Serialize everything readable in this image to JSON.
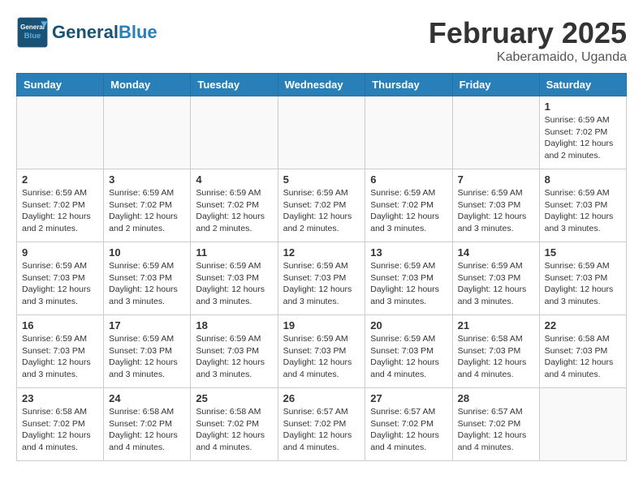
{
  "header": {
    "logo_general": "General",
    "logo_blue": "Blue",
    "month": "February 2025",
    "location": "Kaberamaido, Uganda"
  },
  "days_of_week": [
    "Sunday",
    "Monday",
    "Tuesday",
    "Wednesday",
    "Thursday",
    "Friday",
    "Saturday"
  ],
  "weeks": [
    [
      {
        "day": "",
        "info": ""
      },
      {
        "day": "",
        "info": ""
      },
      {
        "day": "",
        "info": ""
      },
      {
        "day": "",
        "info": ""
      },
      {
        "day": "",
        "info": ""
      },
      {
        "day": "",
        "info": ""
      },
      {
        "day": "1",
        "info": "Sunrise: 6:59 AM\nSunset: 7:02 PM\nDaylight: 12 hours\nand 2 minutes."
      }
    ],
    [
      {
        "day": "2",
        "info": "Sunrise: 6:59 AM\nSunset: 7:02 PM\nDaylight: 12 hours\nand 2 minutes."
      },
      {
        "day": "3",
        "info": "Sunrise: 6:59 AM\nSunset: 7:02 PM\nDaylight: 12 hours\nand 2 minutes."
      },
      {
        "day": "4",
        "info": "Sunrise: 6:59 AM\nSunset: 7:02 PM\nDaylight: 12 hours\nand 2 minutes."
      },
      {
        "day": "5",
        "info": "Sunrise: 6:59 AM\nSunset: 7:02 PM\nDaylight: 12 hours\nand 2 minutes."
      },
      {
        "day": "6",
        "info": "Sunrise: 6:59 AM\nSunset: 7:02 PM\nDaylight: 12 hours\nand 3 minutes."
      },
      {
        "day": "7",
        "info": "Sunrise: 6:59 AM\nSunset: 7:03 PM\nDaylight: 12 hours\nand 3 minutes."
      },
      {
        "day": "8",
        "info": "Sunrise: 6:59 AM\nSunset: 7:03 PM\nDaylight: 12 hours\nand 3 minutes."
      }
    ],
    [
      {
        "day": "9",
        "info": "Sunrise: 6:59 AM\nSunset: 7:03 PM\nDaylight: 12 hours\nand 3 minutes."
      },
      {
        "day": "10",
        "info": "Sunrise: 6:59 AM\nSunset: 7:03 PM\nDaylight: 12 hours\nand 3 minutes."
      },
      {
        "day": "11",
        "info": "Sunrise: 6:59 AM\nSunset: 7:03 PM\nDaylight: 12 hours\nand 3 minutes."
      },
      {
        "day": "12",
        "info": "Sunrise: 6:59 AM\nSunset: 7:03 PM\nDaylight: 12 hours\nand 3 minutes."
      },
      {
        "day": "13",
        "info": "Sunrise: 6:59 AM\nSunset: 7:03 PM\nDaylight: 12 hours\nand 3 minutes."
      },
      {
        "day": "14",
        "info": "Sunrise: 6:59 AM\nSunset: 7:03 PM\nDaylight: 12 hours\nand 3 minutes."
      },
      {
        "day": "15",
        "info": "Sunrise: 6:59 AM\nSunset: 7:03 PM\nDaylight: 12 hours\nand 3 minutes."
      }
    ],
    [
      {
        "day": "16",
        "info": "Sunrise: 6:59 AM\nSunset: 7:03 PM\nDaylight: 12 hours\nand 3 minutes."
      },
      {
        "day": "17",
        "info": "Sunrise: 6:59 AM\nSunset: 7:03 PM\nDaylight: 12 hours\nand 3 minutes."
      },
      {
        "day": "18",
        "info": "Sunrise: 6:59 AM\nSunset: 7:03 PM\nDaylight: 12 hours\nand 3 minutes."
      },
      {
        "day": "19",
        "info": "Sunrise: 6:59 AM\nSunset: 7:03 PM\nDaylight: 12 hours\nand 4 minutes."
      },
      {
        "day": "20",
        "info": "Sunrise: 6:59 AM\nSunset: 7:03 PM\nDaylight: 12 hours\nand 4 minutes."
      },
      {
        "day": "21",
        "info": "Sunrise: 6:58 AM\nSunset: 7:03 PM\nDaylight: 12 hours\nand 4 minutes."
      },
      {
        "day": "22",
        "info": "Sunrise: 6:58 AM\nSunset: 7:03 PM\nDaylight: 12 hours\nand 4 minutes."
      }
    ],
    [
      {
        "day": "23",
        "info": "Sunrise: 6:58 AM\nSunset: 7:02 PM\nDaylight: 12 hours\nand 4 minutes."
      },
      {
        "day": "24",
        "info": "Sunrise: 6:58 AM\nSunset: 7:02 PM\nDaylight: 12 hours\nand 4 minutes."
      },
      {
        "day": "25",
        "info": "Sunrise: 6:58 AM\nSunset: 7:02 PM\nDaylight: 12 hours\nand 4 minutes."
      },
      {
        "day": "26",
        "info": "Sunrise: 6:57 AM\nSunset: 7:02 PM\nDaylight: 12 hours\nand 4 minutes."
      },
      {
        "day": "27",
        "info": "Sunrise: 6:57 AM\nSunset: 7:02 PM\nDaylight: 12 hours\nand 4 minutes."
      },
      {
        "day": "28",
        "info": "Sunrise: 6:57 AM\nSunset: 7:02 PM\nDaylight: 12 hours\nand 4 minutes."
      },
      {
        "day": "",
        "info": ""
      }
    ]
  ]
}
